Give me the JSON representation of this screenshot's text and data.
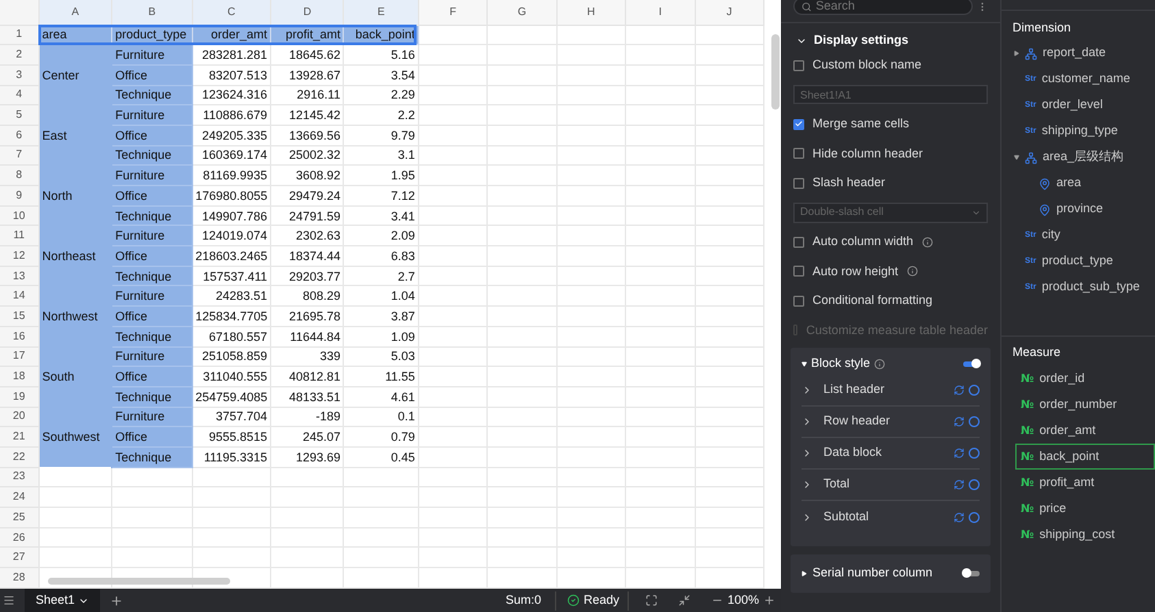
{
  "sheet": {
    "column_letters": [
      "A",
      "B",
      "C",
      "D",
      "E",
      "F",
      "G",
      "H",
      "I",
      "J"
    ],
    "row_numbers": [
      "1",
      "2",
      "3",
      "4",
      "5",
      "6",
      "7",
      "8",
      "9",
      "10",
      "11",
      "12",
      "13",
      "14",
      "15",
      "16",
      "17",
      "18",
      "19",
      "20",
      "21",
      "22",
      "23",
      "24",
      "25",
      "26",
      "27",
      "28"
    ],
    "header": [
      "area",
      "product_type",
      "order_amt",
      "profit_amt",
      "back_point"
    ],
    "groups": [
      {
        "area": "Center",
        "rows": [
          [
            "Furniture",
            "283281.281",
            "18645.62",
            "5.16"
          ],
          [
            "Office",
            "83207.513",
            "13928.67",
            "3.54"
          ],
          [
            "Technique",
            "123624.316",
            "2916.11",
            "2.29"
          ]
        ]
      },
      {
        "area": "East",
        "rows": [
          [
            "Furniture",
            "110886.679",
            "12145.42",
            "2.2"
          ],
          [
            "Office",
            "249205.335",
            "13669.56",
            "9.79"
          ],
          [
            "Technique",
            "160369.174",
            "25002.32",
            "3.1"
          ]
        ]
      },
      {
        "area": "North",
        "rows": [
          [
            "Furniture",
            "81169.9935",
            "3608.92",
            "1.95"
          ],
          [
            "Office",
            "176980.8055",
            "29479.24",
            "7.12"
          ],
          [
            "Technique",
            "149907.786",
            "24791.59",
            "3.41"
          ]
        ]
      },
      {
        "area": "Northeast",
        "rows": [
          [
            "Furniture",
            "124019.074",
            "2302.63",
            "2.09"
          ],
          [
            "Office",
            "218603.2465",
            "18374.44",
            "6.83"
          ],
          [
            "Technique",
            "157537.411",
            "29203.77",
            "2.7"
          ]
        ]
      },
      {
        "area": "Northwest",
        "rows": [
          [
            "Furniture",
            "24283.51",
            "808.29",
            "1.04"
          ],
          [
            "Office",
            "125834.7705",
            "21695.78",
            "3.87"
          ],
          [
            "Technique",
            "67180.557",
            "11644.84",
            "1.09"
          ]
        ]
      },
      {
        "area": "South",
        "rows": [
          [
            "Furniture",
            "251058.859",
            "339",
            "5.03"
          ],
          [
            "Office",
            "311040.555",
            "40812.81",
            "11.55"
          ],
          [
            "Technique",
            "254759.4085",
            "48133.51",
            "4.61"
          ]
        ]
      },
      {
        "area": "Southwest",
        "rows": [
          [
            "Furniture",
            "3757.704",
            "-189",
            "0.1"
          ],
          [
            "Office",
            "9555.8515",
            "245.07",
            "0.79"
          ],
          [
            "Technique",
            "11195.3315",
            "1293.69",
            "0.45"
          ]
        ]
      }
    ]
  },
  "status_bar": {
    "sheet_tab": "Sheet1",
    "sum": "Sum:0",
    "state": "Ready",
    "zoom": "100%"
  },
  "settings": {
    "search": {
      "placeholder": "Search"
    },
    "display": {
      "title": "Display settings",
      "expanded": true,
      "items": [
        {
          "kind": "checkbox",
          "label": "Custom block name",
          "checked": false,
          "disabled": false,
          "info": false
        },
        {
          "kind": "input",
          "placeholder": "Sheet1!A1"
        },
        {
          "kind": "checkbox",
          "label": "Merge same cells",
          "checked": true,
          "disabled": false,
          "info": false
        },
        {
          "kind": "checkbox",
          "label": "Hide column header",
          "checked": false,
          "disabled": false,
          "info": false
        },
        {
          "kind": "checkbox",
          "label": "Slash header",
          "checked": false,
          "disabled": false,
          "info": false
        },
        {
          "kind": "select",
          "value": "Double-slash cell"
        },
        {
          "kind": "checkbox",
          "label": "Auto column width",
          "checked": false,
          "disabled": false,
          "info": true
        },
        {
          "kind": "checkbox",
          "label": "Auto row height",
          "checked": false,
          "disabled": false,
          "info": true
        },
        {
          "kind": "checkbox",
          "label": "Conditional formatting",
          "checked": false,
          "disabled": false,
          "info": false
        },
        {
          "kind": "checkbox",
          "label": "Customize measure table header",
          "checked": false,
          "disabled": true,
          "info": false
        }
      ]
    },
    "block_style": {
      "title": "Block style",
      "expanded": true,
      "on": true,
      "items": [
        "List header",
        "Row header",
        "Data block",
        "Total",
        "Subtotal"
      ]
    },
    "serial": {
      "title": "Serial number column",
      "expanded": false,
      "on": false
    }
  },
  "fields": {
    "dimension": {
      "title": "Dimension",
      "items": [
        {
          "kind": "hierarchy",
          "label": "report_date",
          "expanded": false
        },
        {
          "kind": "text",
          "badge": "Str",
          "label": "customer_name"
        },
        {
          "kind": "text",
          "badge": "Str",
          "label": "order_level"
        },
        {
          "kind": "text",
          "badge": "Str",
          "label": "shipping_type"
        },
        {
          "kind": "hierarchy",
          "label": "area_层级结构",
          "expanded": true,
          "children": [
            {
              "kind": "geo",
              "label": "area"
            },
            {
              "kind": "geo",
              "label": "province"
            }
          ]
        },
        {
          "kind": "text",
          "badge": "Str",
          "label": "city"
        },
        {
          "kind": "text",
          "badge": "Str",
          "label": "product_type"
        },
        {
          "kind": "text",
          "badge": "Str",
          "label": "product_sub_type"
        }
      ]
    },
    "measure": {
      "title": "Measure",
      "items": [
        {
          "badge": "№",
          "label": "order_id",
          "selected": false
        },
        {
          "badge": "№",
          "label": "order_number",
          "selected": false
        },
        {
          "badge": "№",
          "label": "order_amt",
          "selected": false
        },
        {
          "badge": "№",
          "label": "back_point",
          "selected": true
        },
        {
          "badge": "№",
          "label": "profit_amt",
          "selected": false
        },
        {
          "badge": "№",
          "label": "price",
          "selected": false
        },
        {
          "badge": "№",
          "label": "shipping_cost",
          "selected": false
        }
      ]
    }
  }
}
